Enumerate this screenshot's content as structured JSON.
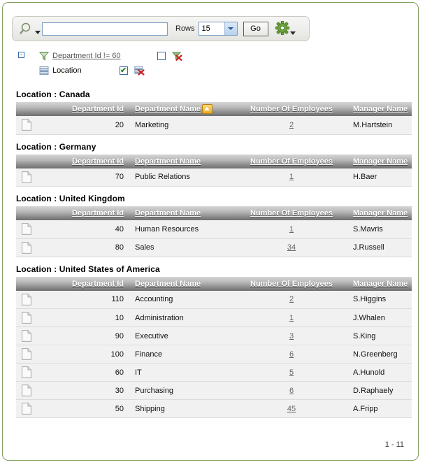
{
  "toolbar": {
    "search_icon": "magnifier-icon",
    "search_value": "",
    "search_placeholder": "",
    "rows_label": "Rows",
    "rows_value": "15",
    "rows_options": [
      "15"
    ],
    "go_label": "Go",
    "actions_icon": "gear-icon"
  },
  "controls": {
    "expander": "-",
    "items": [
      {
        "icon": "filter-funnel-icon",
        "label": "Department Id != 60",
        "is_link": true,
        "checked": false,
        "remove_icon": "remove-filter-icon"
      },
      {
        "icon": "control-break-icon",
        "label": "Location",
        "is_link": false,
        "checked": true,
        "remove_icon": "remove-control-break-icon"
      }
    ]
  },
  "report": {
    "columns": [
      "Department Id",
      "Department Name",
      "Number Of Employees",
      "Manager Name"
    ],
    "sort_column": "Department Name",
    "sort_direction": "asc",
    "row_icon": "document-icon",
    "groups": [
      {
        "title": "Location : Canada",
        "show_sort_arrow": true,
        "rows": [
          {
            "id": "20",
            "name": "Marketing",
            "employees": "2",
            "manager": "M.Hartstein"
          }
        ]
      },
      {
        "title": "Location : Germany",
        "show_sort_arrow": false,
        "rows": [
          {
            "id": "70",
            "name": "Public Relations",
            "employees": "1",
            "manager": "H.Baer"
          }
        ]
      },
      {
        "title": "Location : United Kingdom",
        "show_sort_arrow": false,
        "rows": [
          {
            "id": "40",
            "name": "Human Resources",
            "employees": "1",
            "manager": "S.Mavris"
          },
          {
            "id": "80",
            "name": "Sales",
            "employees": "34",
            "manager": "J.Russell"
          }
        ]
      },
      {
        "title": "Location : United States of America",
        "show_sort_arrow": false,
        "rows": [
          {
            "id": "110",
            "name": "Accounting",
            "employees": "2",
            "manager": "S.Higgins"
          },
          {
            "id": "10",
            "name": "Administration",
            "employees": "1",
            "manager": "J.Whalen"
          },
          {
            "id": "90",
            "name": "Executive",
            "employees": "3",
            "manager": "S.King"
          },
          {
            "id": "100",
            "name": "Finance",
            "employees": "6",
            "manager": "N.Greenberg"
          },
          {
            "id": "60",
            "name": "IT",
            "employees": "5",
            "manager": "A.Hunold"
          },
          {
            "id": "30",
            "name": "Purchasing",
            "employees": "6",
            "manager": "D.Raphaely"
          },
          {
            "id": "50",
            "name": "Shipping",
            "employees": "45",
            "manager": "A.Fripp"
          }
        ]
      }
    ]
  },
  "pagination": {
    "range": "1 - 11"
  },
  "colors": {
    "page_border": "#7f9f5f",
    "header_dark": "#6e6e6e",
    "row_bg": "#f1f1f1",
    "sort_arrow": "#f0a91d",
    "checkbox_border": "#3a6ea5",
    "check_green": "#2c8a2c"
  }
}
